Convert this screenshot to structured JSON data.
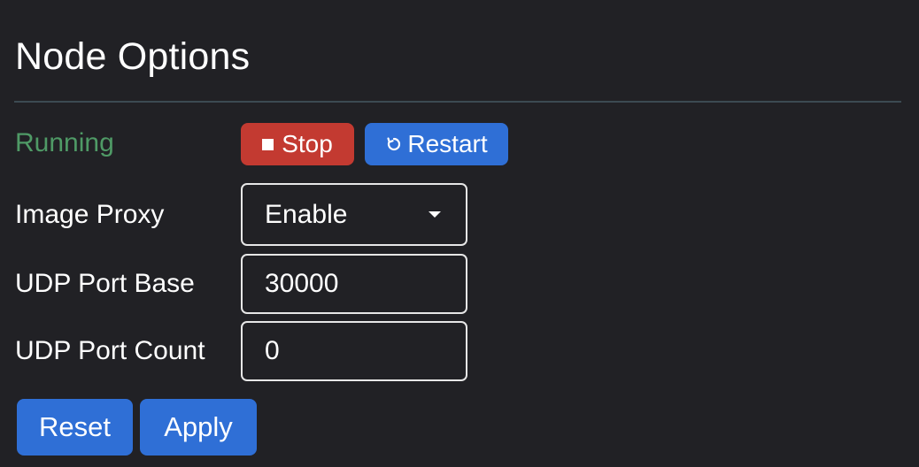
{
  "title": "Node Options",
  "status": {
    "text": "Running",
    "color": "#4f9a66"
  },
  "controls": {
    "stop_label": "Stop",
    "stop_icon": "stop-square-icon",
    "restart_label": "Restart",
    "restart_icon": "restart-icon"
  },
  "fields": {
    "image_proxy": {
      "label": "Image Proxy",
      "value": "Enable"
    },
    "udp_port_base": {
      "label": "UDP Port Base",
      "value": "30000"
    },
    "udp_port_count": {
      "label": "UDP Port Count",
      "value": "0"
    }
  },
  "actions": {
    "reset_label": "Reset",
    "apply_label": "Apply"
  },
  "colors": {
    "background": "#212125",
    "stop_button": "#c33a31",
    "primary_button": "#2f6fd6",
    "divider": "#3c4a52"
  }
}
